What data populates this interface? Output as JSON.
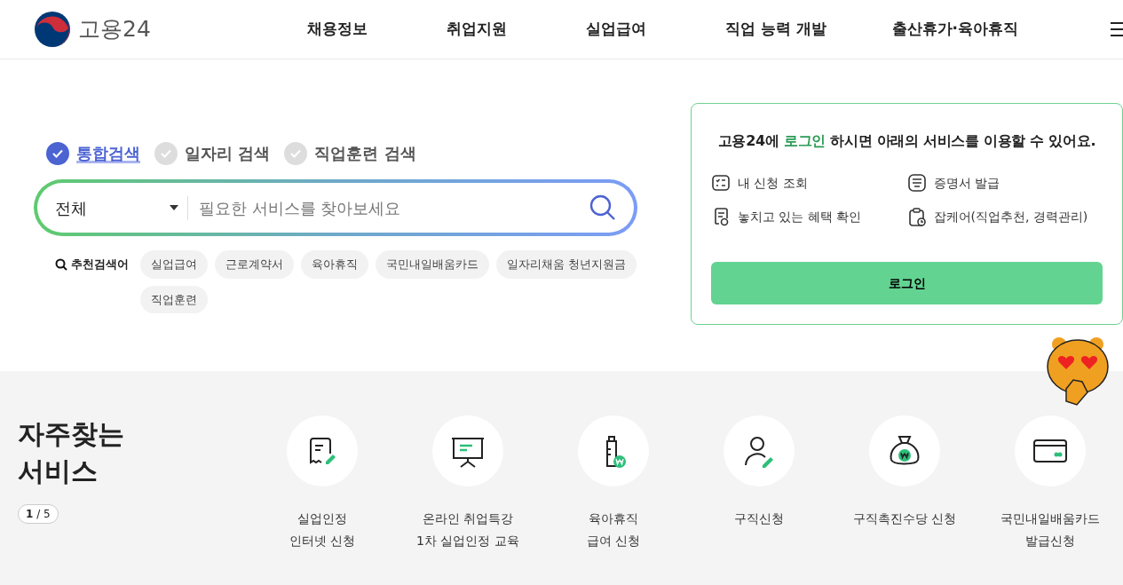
{
  "header": {
    "logo_text": "고용24",
    "nav": [
      "채용정보",
      "취업지원",
      "실업급여",
      "직업 능력 개발",
      "출산휴가·육아휴직"
    ]
  },
  "search": {
    "tabs": [
      {
        "label": "통합검색",
        "selected": true
      },
      {
        "label": "일자리 검색",
        "selected": false
      },
      {
        "label": "직업훈련 검색",
        "selected": false
      }
    ],
    "category": "전체",
    "placeholder": "필요한 서비스를 찾아보세요",
    "recommend_label": "추천검색어",
    "keywords": [
      "실업급여",
      "근로계약서",
      "육아휴직",
      "국민내일배움카드",
      "일자리채움 청년지원금",
      "직업훈련"
    ]
  },
  "login_panel": {
    "message_prefix": "고용24에 ",
    "message_highlight": "로그인",
    "message_suffix": " 하시면 아래의 서비스를 이용할 수 있어요.",
    "services": [
      {
        "kind": "checklist",
        "label": "내 신청 조회"
      },
      {
        "kind": "certificate",
        "label": "증명서 발급"
      },
      {
        "kind": "document",
        "label": "놓치고 있는 혜택 확인"
      },
      {
        "kind": "clipboard",
        "label": "잡케어(직업추천, 경력관리)"
      }
    ],
    "button": "로그인"
  },
  "frequent": {
    "title": "자주찾는\n서비스",
    "pager": "**1** / 5",
    "items": [
      {
        "kind": "receipt",
        "label": "실업인정\n인터넷 신청"
      },
      {
        "kind": "board",
        "label": "온라인 취업특강\n1차 실업인정 교육"
      },
      {
        "kind": "bottle",
        "label": "육아휴직\n급여 신청"
      },
      {
        "kind": "person",
        "label": "구직신청"
      },
      {
        "kind": "moneybag",
        "label": "구직촉진수당 신청"
      },
      {
        "kind": "card",
        "label": "국민내일배움카드\n발급신청"
      }
    ]
  }
}
